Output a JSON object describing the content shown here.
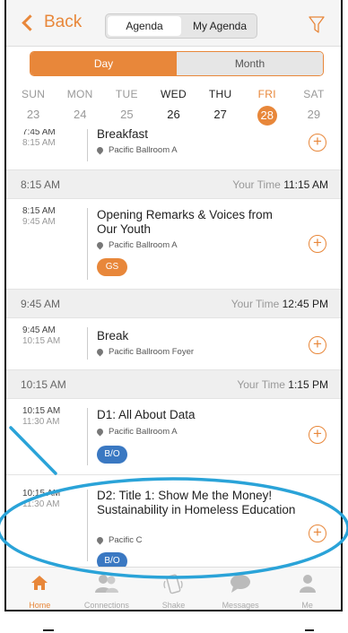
{
  "header": {
    "back_label": "Back",
    "tabs": [
      {
        "label": "Agenda",
        "active": true
      },
      {
        "label": "My Agenda",
        "active": false
      }
    ],
    "filter_icon": "filter-icon"
  },
  "view_toggle": {
    "day_label": "Day",
    "month_label": "Month",
    "selected": "Day"
  },
  "week": [
    {
      "name": "SUN",
      "date": "23"
    },
    {
      "name": "MON",
      "date": "24"
    },
    {
      "name": "TUE",
      "date": "25"
    },
    {
      "name": "WED",
      "date": "26"
    },
    {
      "name": "THU",
      "date": "27"
    },
    {
      "name": "FRI",
      "date": "28"
    },
    {
      "name": "SAT",
      "date": "29"
    }
  ],
  "your_time_label": "Your Time",
  "schedule": {
    "s0": {
      "start": "7:45 AM",
      "end": "8:15 AM",
      "title": "Breakfast",
      "location": "Pacific Ballroom A"
    },
    "g1": {
      "time": "8:15 AM",
      "your_time": "11:15 AM"
    },
    "s1": {
      "start": "8:15 AM",
      "end": "9:45 AM",
      "title": "Opening Remarks & Voices from Our Youth",
      "location": "Pacific Ballroom A",
      "badge": "GS"
    },
    "g2": {
      "time": "9:45 AM",
      "your_time": "12:45 PM"
    },
    "s2": {
      "start": "9:45 AM",
      "end": "10:15 AM",
      "title": "Break",
      "location": "Pacific Ballroom Foyer"
    },
    "g3": {
      "time": "10:15 AM",
      "your_time": "1:15 PM"
    },
    "s3": {
      "start": "10:15 AM",
      "end": "11:30 AM",
      "title": "D1: All About Data",
      "location": "Pacific Ballroom A",
      "badge": "B/O"
    },
    "s4": {
      "start": "10:15 AM",
      "end": "11:30 AM",
      "title": "D2: Title 1: Show Me the Money! Sustainability in Homeless Education",
      "location": "Pacific C",
      "badge": "B/O"
    }
  },
  "tabbar": [
    {
      "label": "Home",
      "icon": "home-icon",
      "active": true
    },
    {
      "label": "Connections",
      "icon": "connections-icon",
      "active": false
    },
    {
      "label": "Shake",
      "icon": "shake-icon",
      "active": false
    },
    {
      "label": "Messages",
      "icon": "messages-icon",
      "active": false
    },
    {
      "label": "Me",
      "icon": "me-icon",
      "active": false
    }
  ],
  "colors": {
    "accent": "#e8873a",
    "badge_gs": "#e8873a",
    "badge_bo": "#3a78c2",
    "highlight_annotation": "#2aa3d8"
  }
}
